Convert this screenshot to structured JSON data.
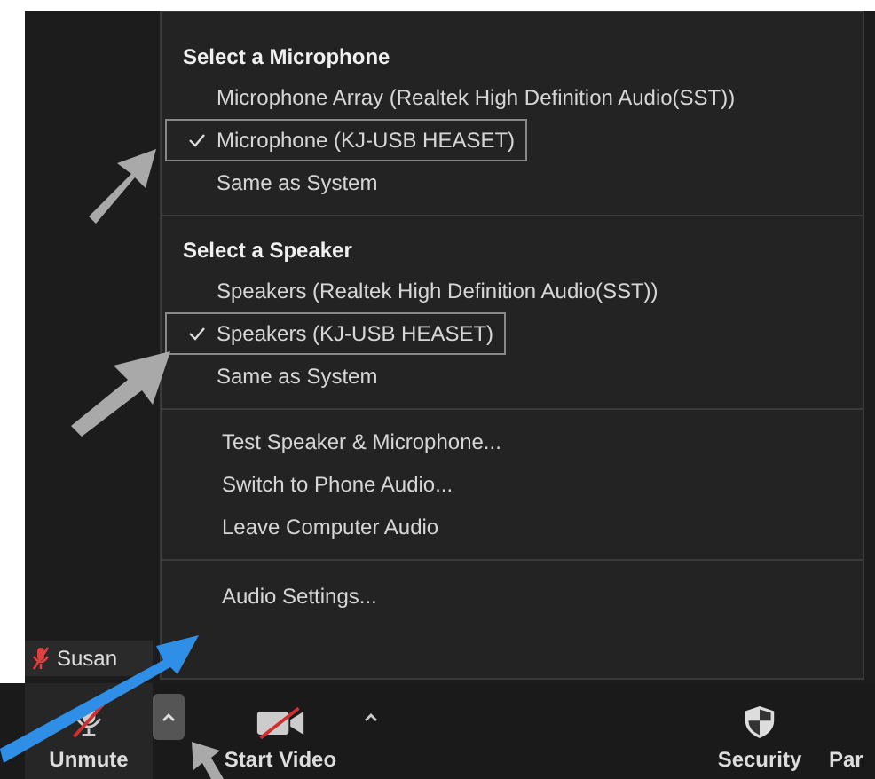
{
  "audio_menu": {
    "sections": [
      {
        "heading": "Select a Microphone",
        "items": [
          {
            "label": "Microphone Array (Realtek High Definition Audio(SST))",
            "selected": false
          },
          {
            "label": "Microphone (KJ-USB HEASET)",
            "selected": true
          },
          {
            "label": "Same as System",
            "selected": false
          }
        ]
      },
      {
        "heading": "Select a Speaker",
        "items": [
          {
            "label": "Speakers (Realtek High Definition Audio(SST))",
            "selected": false
          },
          {
            "label": "Speakers (KJ-USB HEASET)",
            "selected": true
          },
          {
            "label": "Same as System",
            "selected": false
          }
        ]
      }
    ],
    "actions": [
      "Test Speaker & Microphone...",
      "Switch to Phone Audio...",
      "Leave Computer Audio"
    ],
    "settings": "Audio Settings..."
  },
  "participant": {
    "name": "Susan"
  },
  "toolbar": {
    "unmute": "Unmute",
    "start_video": "Start Video",
    "security": "Security",
    "participants": "Par"
  }
}
